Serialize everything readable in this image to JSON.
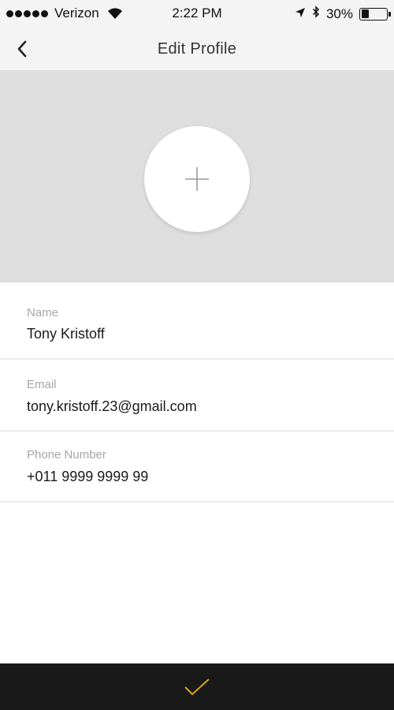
{
  "status_bar": {
    "carrier": "Verizon",
    "time": "2:22 PM",
    "battery_percent": "30%",
    "battery_level": 0.3,
    "signal_dots": 5,
    "icons": [
      "wifi-icon",
      "location-arrow-icon",
      "bluetooth-icon",
      "battery-icon"
    ]
  },
  "nav": {
    "title": "Edit Profile",
    "back_icon": "chevron-left-icon"
  },
  "photo": {
    "add_icon": "plus-icon"
  },
  "form": {
    "name": {
      "label": "Name",
      "value": "Tony Kristoff"
    },
    "email": {
      "label": "Email",
      "value": "tony.kristoff.23@gmail.com"
    },
    "phone": {
      "label": "Phone Number",
      "value": "+011 9999 9999 99"
    }
  },
  "footer": {
    "confirm_icon": "checkmark-icon",
    "accent_color": "#e0a21c"
  }
}
